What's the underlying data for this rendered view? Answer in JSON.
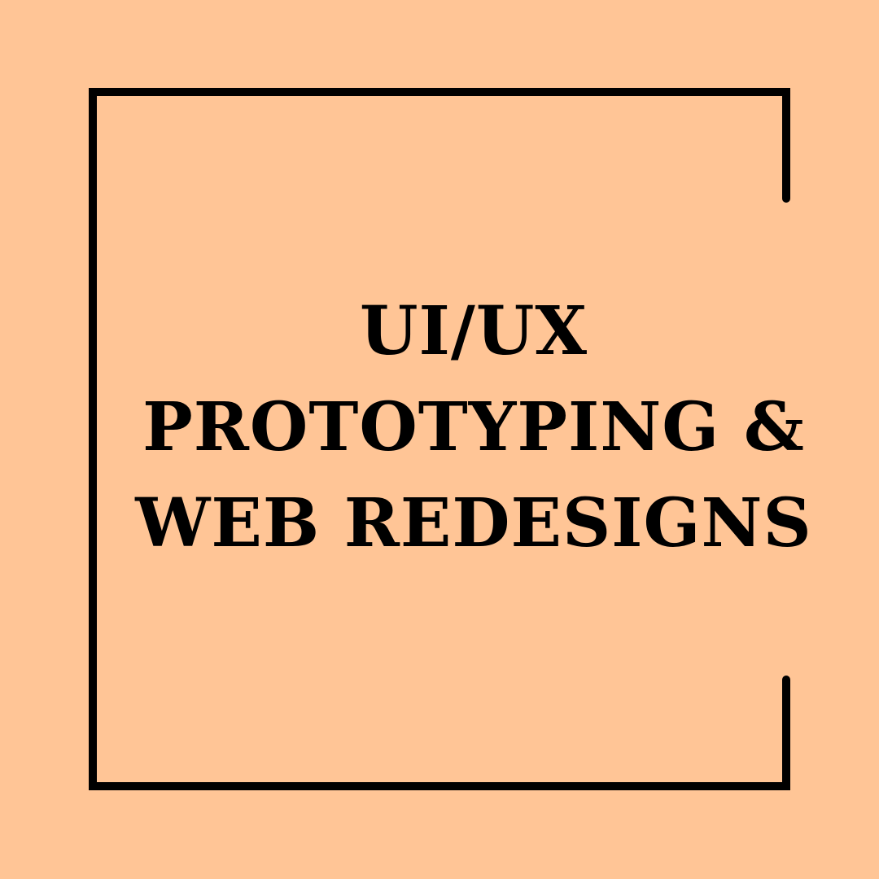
{
  "colors": {
    "background": "#FFC596",
    "frame": "#000000",
    "text": "#000000"
  },
  "title": {
    "line1": "UI/UX",
    "line2": "PROTOTYPING &",
    "line3": "WEB REDESIGNS"
  }
}
